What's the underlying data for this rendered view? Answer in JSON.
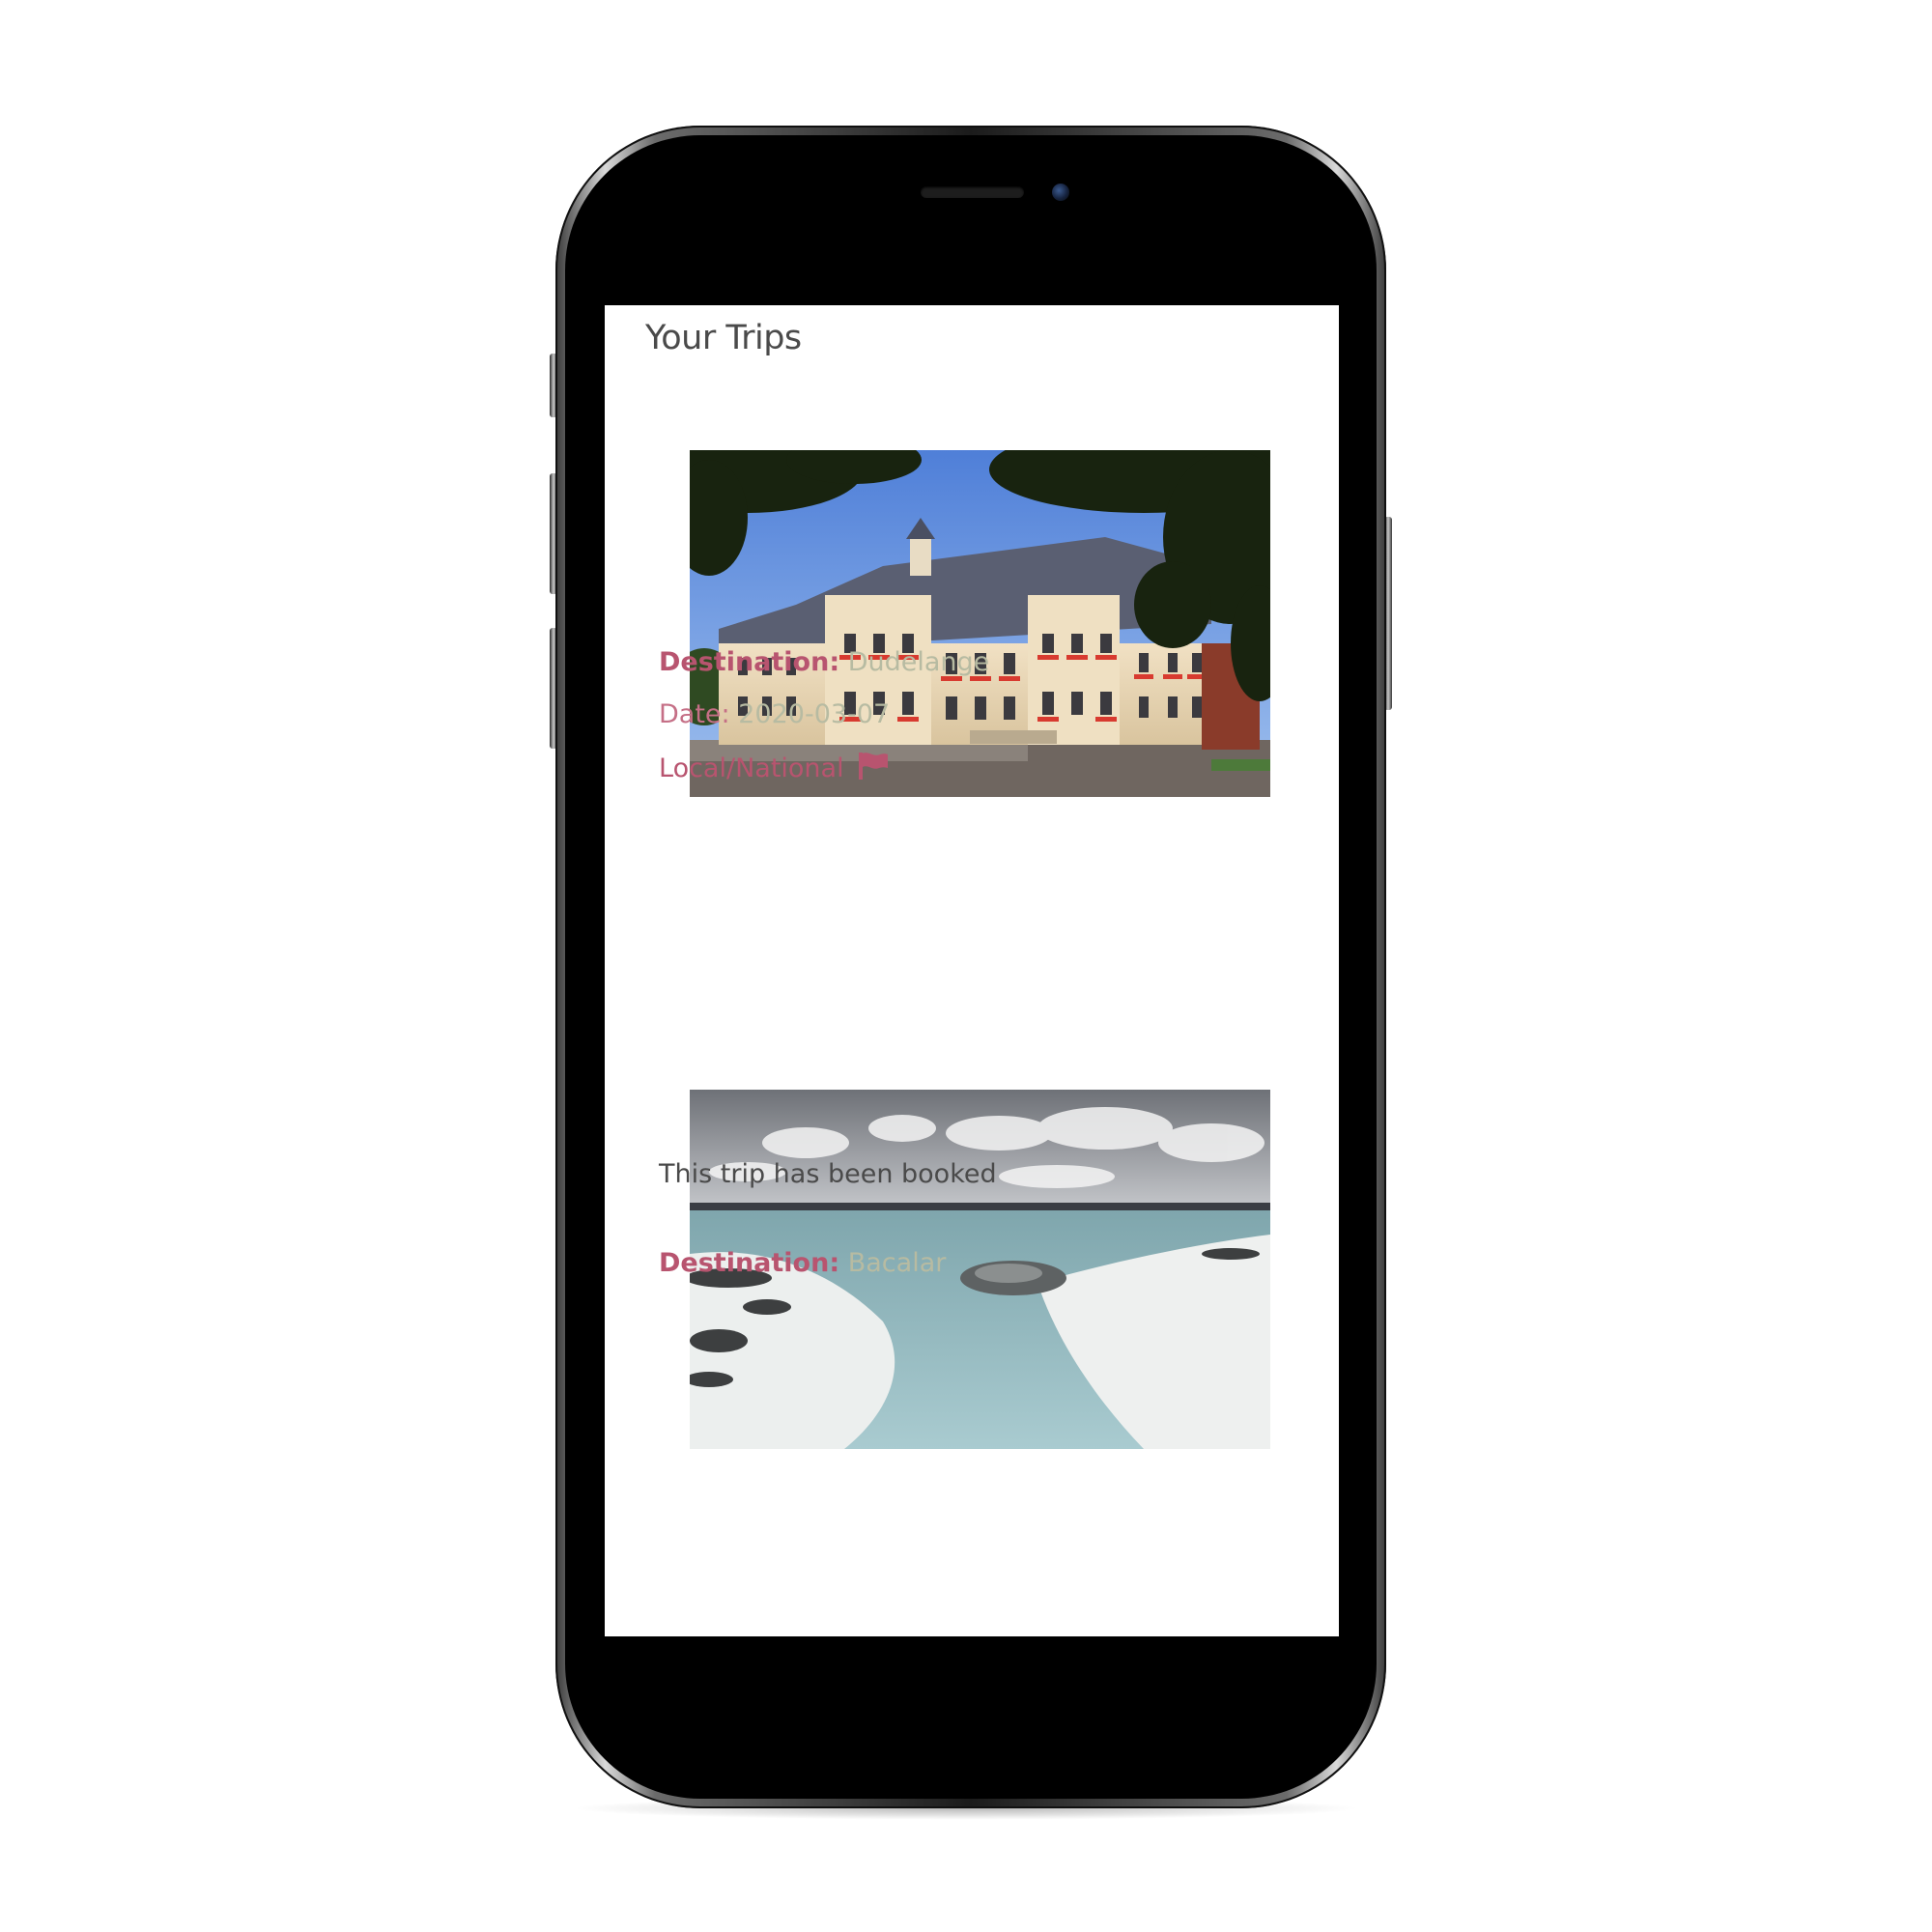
{
  "header": {
    "title": "Your Trips"
  },
  "trips": [
    {
      "destination_label": "Destination:",
      "destination": "Dudelange",
      "date_label": "Date:",
      "date": "2020-03-07",
      "category": "Local/National",
      "category_icon": "flag-icon",
      "photo": "town-hall-photo"
    },
    {
      "status": "This trip has been booked",
      "destination_label": "Destination:",
      "destination": "Bacalar",
      "photo": "lagoon-photo"
    }
  ],
  "colors": {
    "accent": "#b8546f",
    "value": "#b7bba2",
    "title": "#4a4a4a"
  }
}
